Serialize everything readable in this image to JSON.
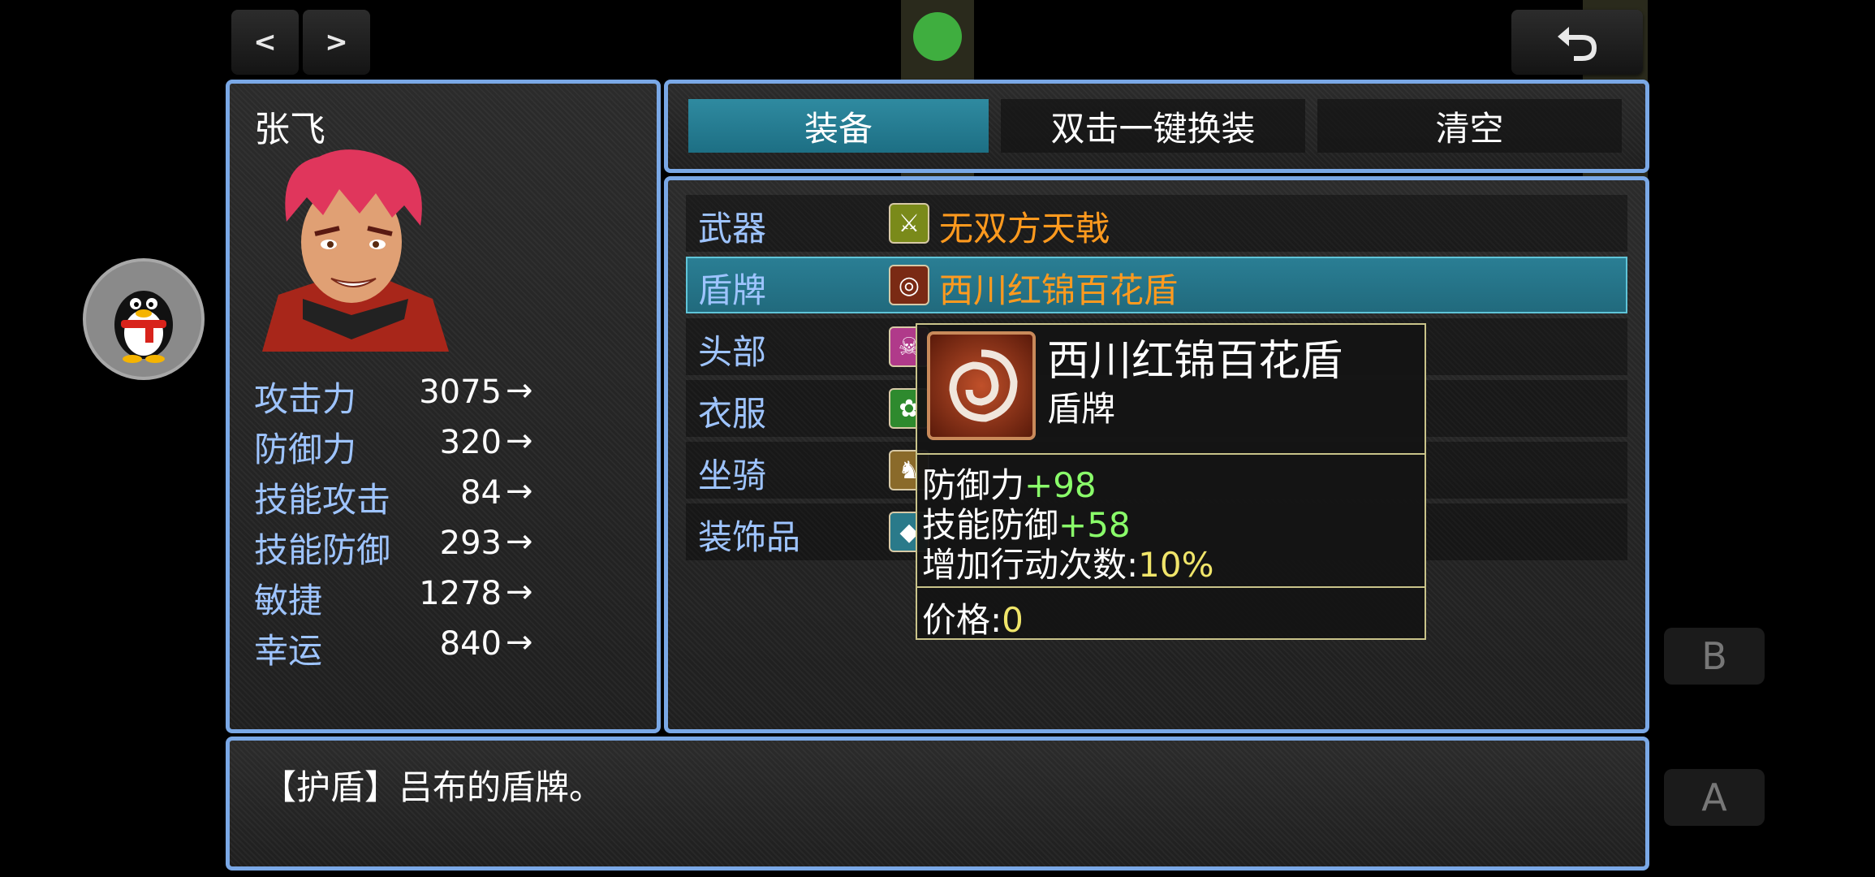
{
  "nav": {
    "prev": "<",
    "next": ">"
  },
  "character": {
    "name": "张飞",
    "stats": [
      {
        "label": "攻击力",
        "value": "3075",
        "arrow": "→"
      },
      {
        "label": "防御力",
        "value": "320",
        "arrow": "→"
      },
      {
        "label": "技能攻击",
        "value": "84",
        "arrow": "→"
      },
      {
        "label": "技能防御",
        "value": "293",
        "arrow": "→"
      },
      {
        "label": "敏捷",
        "value": "1278",
        "arrow": "→"
      },
      {
        "label": "幸运",
        "value": "840",
        "arrow": "→"
      }
    ]
  },
  "tabs": [
    {
      "label": "装备",
      "selected": true
    },
    {
      "label": "双击一键换装",
      "selected": false
    },
    {
      "label": "清空",
      "selected": false
    }
  ],
  "slots": [
    {
      "slot": "武器",
      "item": "无双方天戟",
      "icon": "halberd-icon"
    },
    {
      "slot": "盾牌",
      "item": "西川红锦百花盾",
      "icon": "shield-swirl-icon"
    },
    {
      "slot": "头部",
      "item": "",
      "icon": "helmet-icon"
    },
    {
      "slot": "衣服",
      "item": "",
      "icon": "armor-icon"
    },
    {
      "slot": "坐骑",
      "item": "",
      "icon": "horse-icon"
    },
    {
      "slot": "装饰品",
      "item": "",
      "icon": "accessory-icon"
    }
  ],
  "tooltip": {
    "name": "西川红锦百花盾",
    "type": "盾牌",
    "lines": [
      {
        "label": "防御力",
        "value": "+98"
      },
      {
        "label": "技能防御",
        "value": "+58"
      },
      {
        "label": "增加行动次数:",
        "value": "10%"
      }
    ],
    "price_label": "价格:",
    "price_value": "0"
  },
  "description": "【护盾】吕布的盾牌。",
  "controls": {
    "b": "B",
    "a": "A"
  },
  "colors": {
    "window_border": "#7aa8e6",
    "item_text": "#ff9a1e",
    "bonus_green": "#8aff6a",
    "price_yellow": "#f0e56a"
  }
}
